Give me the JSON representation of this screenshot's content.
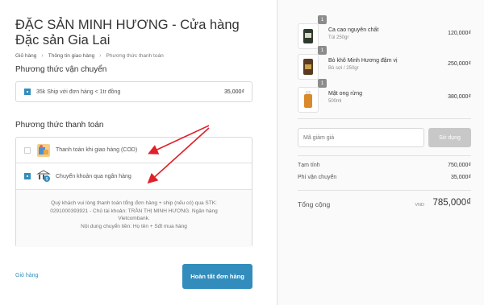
{
  "shop": {
    "title": "ĐẶC SẢN MINH HƯƠNG - Cửa hàng Đặc sản Gia Lai"
  },
  "breadcrumb": [
    "Giỏ hàng",
    "Thông tin giao hàng",
    "Phương thức thanh toán"
  ],
  "shipping": {
    "title": "Phương thức vận chuyển",
    "option_label": "35k Ship với đơn hàng < 1tr đồng",
    "option_price": "35,000₫"
  },
  "payment": {
    "title": "Phương thức thanh toán",
    "methods": [
      {
        "label": "Thanh toán khi giao hàng (COD)",
        "icon": "cod-box-icon",
        "selected": false
      },
      {
        "label": "Chuyển khoản qua ngân hàng",
        "icon": "bank-transfer-icon",
        "selected": true
      }
    ],
    "instructions": [
      "Quý khách vui lòng thanh toán tổng đơn hàng + ship (nếu có) qua STK:",
      "0291000393921 - Chủ tài khoản: TRẦN THỊ MINH HƯƠNG. Ngân hàng",
      "Vietcombank.",
      "Nội dung chuyển tiền: Họ tên + Sđt mua hàng"
    ]
  },
  "footer": {
    "return_label": "Giỏ hàng",
    "complete_label": "Hoàn tất đơn hàng"
  },
  "order": {
    "products": [
      {
        "name": "Ca cao nguyên chất",
        "variant": "Túi 250gr",
        "price": "120,000₫",
        "qty": "1",
        "thumb_color": "#2f3a2f"
      },
      {
        "name": "Bò khô Minh Hương đậm vị",
        "variant": "Bò sợi / 250gr",
        "price": "250,000₫",
        "qty": "1",
        "thumb_color": "#5a3a22"
      },
      {
        "name": "Mật ong rừng",
        "variant": "500ml",
        "price": "380,000₫",
        "qty": "1",
        "thumb_color": "#d98a2b"
      }
    ],
    "discount_placeholder": "Mã giảm giá",
    "discount_button": "Sử dụng",
    "subtotal_label": "Tạm tính",
    "subtotal_value": "750,000₫",
    "shipping_label": "Phí vận chuyển",
    "shipping_value": "35,000₫",
    "total_label": "Tổng cộng",
    "total_currency": "VND",
    "total_value": "785,000₫"
  },
  "colors": {
    "accent": "#338dbc",
    "annotation_arrow": "#e0202a"
  }
}
